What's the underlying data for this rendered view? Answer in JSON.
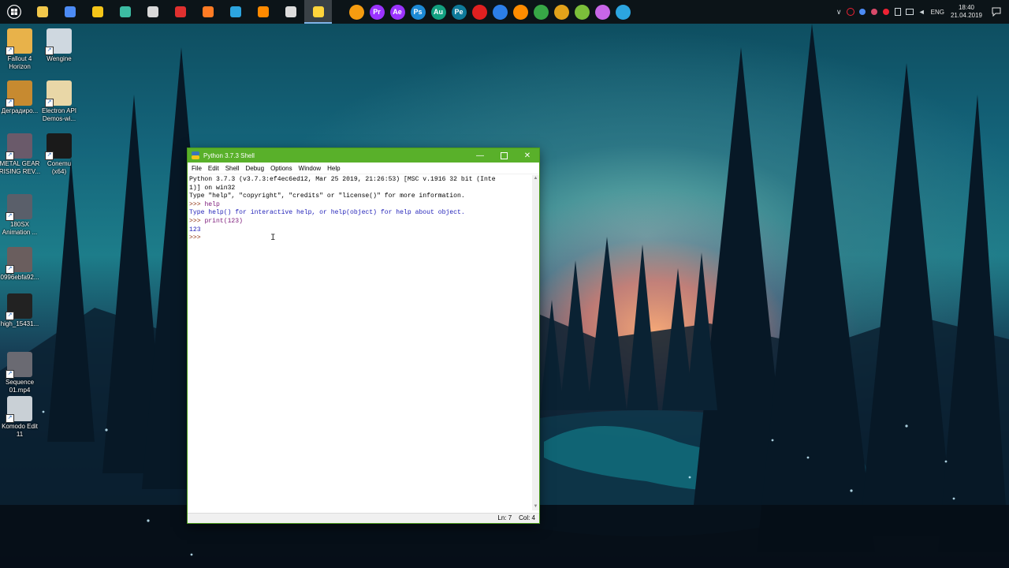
{
  "taskbar": {
    "apps": [
      {
        "name": "file-explorer",
        "color": "#f2c84b"
      },
      {
        "name": "chrome",
        "color": "#4c8bf5"
      },
      {
        "name": "notes",
        "color": "#f5c518"
      },
      {
        "name": "editor",
        "color": "#3cbca3"
      },
      {
        "name": "box",
        "color": "#d9d9d9"
      },
      {
        "name": "recorder",
        "color": "#e0302f"
      },
      {
        "name": "firefox",
        "color": "#ff7b24"
      },
      {
        "name": "telegram",
        "color": "#2ca5e0"
      },
      {
        "name": "sublime",
        "color": "#ff8a00"
      },
      {
        "name": "terminal",
        "color": "#dddddd"
      },
      {
        "name": "python-idle",
        "color": "#ffd43b"
      }
    ],
    "pinned": [
      {
        "label": "",
        "name": "sublime-pin-icon",
        "bg": "#f59c10"
      },
      {
        "label": "Pr",
        "name": "premiere-icon",
        "bg": "#9b33ff"
      },
      {
        "label": "Ae",
        "name": "after-effects-icon",
        "bg": "#9b33ff"
      },
      {
        "label": "Ps",
        "name": "photoshop-icon",
        "bg": "#1c8ad6"
      },
      {
        "label": "Au",
        "name": "audition-icon",
        "bg": "#13a080"
      },
      {
        "label": "Pe",
        "name": "pe-icon",
        "bg": "#0e7a9a"
      },
      {
        "label": "",
        "name": "record-icon",
        "bg": "#e02020"
      },
      {
        "label": "",
        "name": "headphones-icon",
        "bg": "#2c7ee8"
      },
      {
        "label": "",
        "name": "vlc-icon",
        "bg": "#ff8c00"
      },
      {
        "label": "",
        "name": "utorrent-icon",
        "bg": "#37a846"
      },
      {
        "label": "",
        "name": "color-wheel-icon",
        "bg": "#e2a21a"
      },
      {
        "label": "",
        "name": "android-icon",
        "bg": "#7bbf3a"
      },
      {
        "label": "",
        "name": "itunes-icon",
        "bg": "#c866e8"
      },
      {
        "label": "",
        "name": "telegram-pin-icon",
        "bg": "#2ca5e0"
      }
    ],
    "tray": {
      "lang": "ENG",
      "time": "18:40",
      "date": "21.04.2019"
    }
  },
  "desktop_icons": [
    {
      "label": "Fallout 4\nHorizon",
      "color": "#e8b24a"
    },
    {
      "label": "Wengine",
      "color": "#cfd8e0"
    },
    {
      "label": "Деградиро...",
      "color": "#c78a30"
    },
    {
      "label": "Electron API\nDemos-wi...",
      "color": "#e9d7a7"
    },
    {
      "label": "METAL GEAR\nRISING REV...",
      "color": "#6a5a6a"
    },
    {
      "label": "Conemu\n(x64)",
      "color": "#1a1a1a"
    },
    {
      "label": "180SX\nAnimation ...",
      "color": "#5a5f6a"
    },
    {
      "label": "0996ebfa92...",
      "color": "#6a5e5e"
    },
    {
      "label": "high_15431...",
      "color": "#222222"
    },
    {
      "label": "Sequence\n01.mp4",
      "color": "#6a6a72"
    },
    {
      "label": "Komodo Edit\n11",
      "color": "#c9d0d6"
    }
  ],
  "window": {
    "title": "Python 3.7.3 Shell",
    "menu": [
      "File",
      "Edit",
      "Shell",
      "Debug",
      "Options",
      "Window",
      "Help"
    ],
    "lines": [
      {
        "prompt": "",
        "text": "Python 3.7.3 (v3.7.3:ef4ec6ed12, Mar 25 2019, 21:26:53) [MSC v.1916 32 bit (Inte",
        "cls": "c-input"
      },
      {
        "prompt": "",
        "text": "1)] on win32",
        "cls": "c-input"
      },
      {
        "prompt": "",
        "text": "Type \"help\", \"copyright\", \"credits\" or \"license()\" for more information.",
        "cls": "c-input"
      },
      {
        "prompt": ">>> ",
        "text": "help",
        "cls": "c-help"
      },
      {
        "prompt": "",
        "text": "Type help() for interactive help, or help(object) for help about object.",
        "cls": "c-out"
      },
      {
        "prompt": ">>> ",
        "text": "print(123)",
        "cls": "c-help"
      },
      {
        "prompt": "",
        "text": "123",
        "cls": "c-out"
      },
      {
        "prompt": ">>> ",
        "text": "",
        "cls": "c-input"
      }
    ],
    "status": {
      "line": "Ln: 7",
      "col": "Col: 4"
    }
  }
}
